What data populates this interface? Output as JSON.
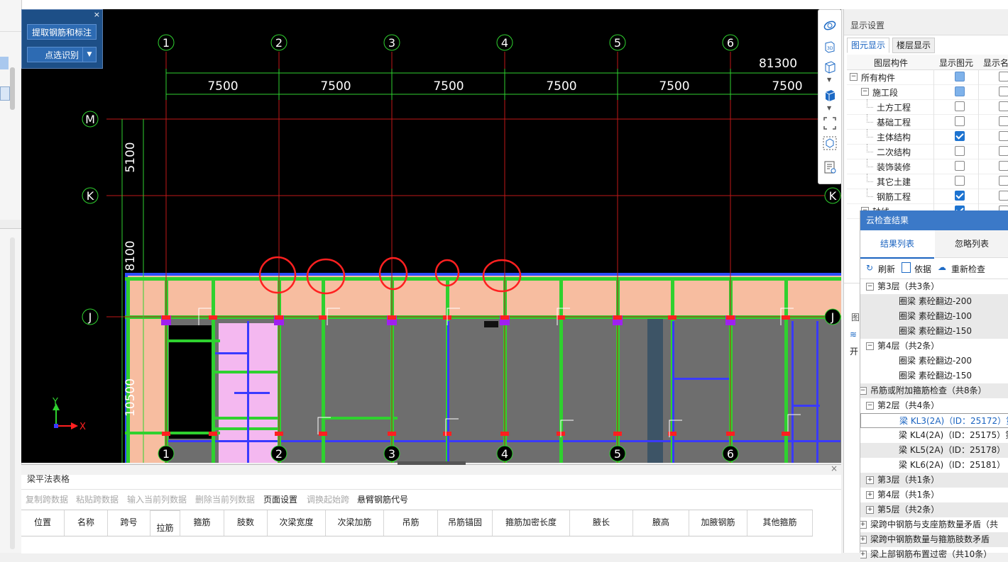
{
  "floating_panel": {
    "extract_btn": "提取钢筋和标注",
    "pick_btn": "点选识别",
    "close": "×"
  },
  "drawing": {
    "axis_numbers": [
      "1",
      "2",
      "3",
      "4",
      "5",
      "6"
    ],
    "axis_letters": [
      "M",
      "K",
      "J"
    ],
    "total_dim": "81300",
    "span_dims": [
      "7500",
      "7500",
      "7500",
      "7500",
      "7500",
      "7500"
    ],
    "vertical_dims": [
      "5100",
      "8100",
      "10500"
    ],
    "ucs_y": "Y",
    "ucs_x": "X"
  },
  "right_panel": {
    "title": "显示设置",
    "tabs": [
      "图元显示",
      "楼层显示"
    ],
    "col_component": "图层构件",
    "col_show": "显示图元",
    "col_name": "显示名",
    "rows": [
      {
        "label": "所有构件",
        "show": "part",
        "name": false
      },
      {
        "label": "施工段",
        "show": "part",
        "name": false
      },
      {
        "label": "土方工程",
        "show": false,
        "name": false
      },
      {
        "label": "基础工程",
        "show": false,
        "name": false
      },
      {
        "label": "主体结构",
        "show": true,
        "name": false
      },
      {
        "label": "二次结构",
        "show": false,
        "name": false
      },
      {
        "label": "装饰装修",
        "show": false,
        "name": false
      },
      {
        "label": "其它土建",
        "show": false,
        "name": false
      },
      {
        "label": "钢筋工程",
        "show": true,
        "name": false
      },
      {
        "label": "轴线",
        "show": true,
        "name": false
      }
    ]
  },
  "cloud_check": {
    "title": "云检查结果",
    "tab_results": "结果列表",
    "tab_ignore": "忽略列表",
    "refresh": "刷新",
    "basis": "依据",
    "recheck": "重新检查",
    "items": [
      "第3层（共3条）",
      "圈梁 素砼翻边-200",
      "圈梁 素砼翻边-100",
      "圈梁 素砼翻边-150",
      "第4层（共2条）",
      "圈梁 素砼翻边-200",
      "圈梁 素砼翻边-150",
      "吊筋或附加箍筋检查（共8条）",
      "第2层（共4条）",
      "梁 KL3(2A)（ID：25172）第",
      "梁 KL4(2A)（ID：25175）第",
      "梁 KL5(2A)（ID：25178）",
      "梁 KL6(2A)（ID：25181）",
      "第3层（共1条）",
      "第4层（共1条）",
      "第5层（共2条）",
      "梁跨中钢筋与支座筋数量矛盾（共",
      "梁跨中钢筋数量与箍筋肢数矛盾",
      "梁上部钢筋布置过密（共10条）"
    ]
  },
  "side_panel_fragments": {
    "label1": "图",
    "label2": "开"
  },
  "bottom_panel": {
    "title": "梁平法表格",
    "close": "×",
    "tools": [
      {
        "label": "复制跨数据",
        "enabled": false
      },
      {
        "label": "粘贴跨数据",
        "enabled": false
      },
      {
        "label": "输入当前列数据",
        "enabled": false
      },
      {
        "label": "删除当前列数据",
        "enabled": false
      },
      {
        "label": "页面设置",
        "enabled": true
      },
      {
        "label": "调换起始跨",
        "enabled": false
      },
      {
        "label": "悬臂钢筋代号",
        "enabled": true
      }
    ],
    "columns": [
      "位置",
      "名称",
      "跨号",
      "拉筋",
      "箍筋",
      "肢数",
      "次梁宽度",
      "次梁加筋",
      "吊筋",
      "吊筋锚固",
      "箍筋加密长度",
      "腋长",
      "腋高",
      "加腋钢筋",
      "其他箍筋"
    ]
  }
}
